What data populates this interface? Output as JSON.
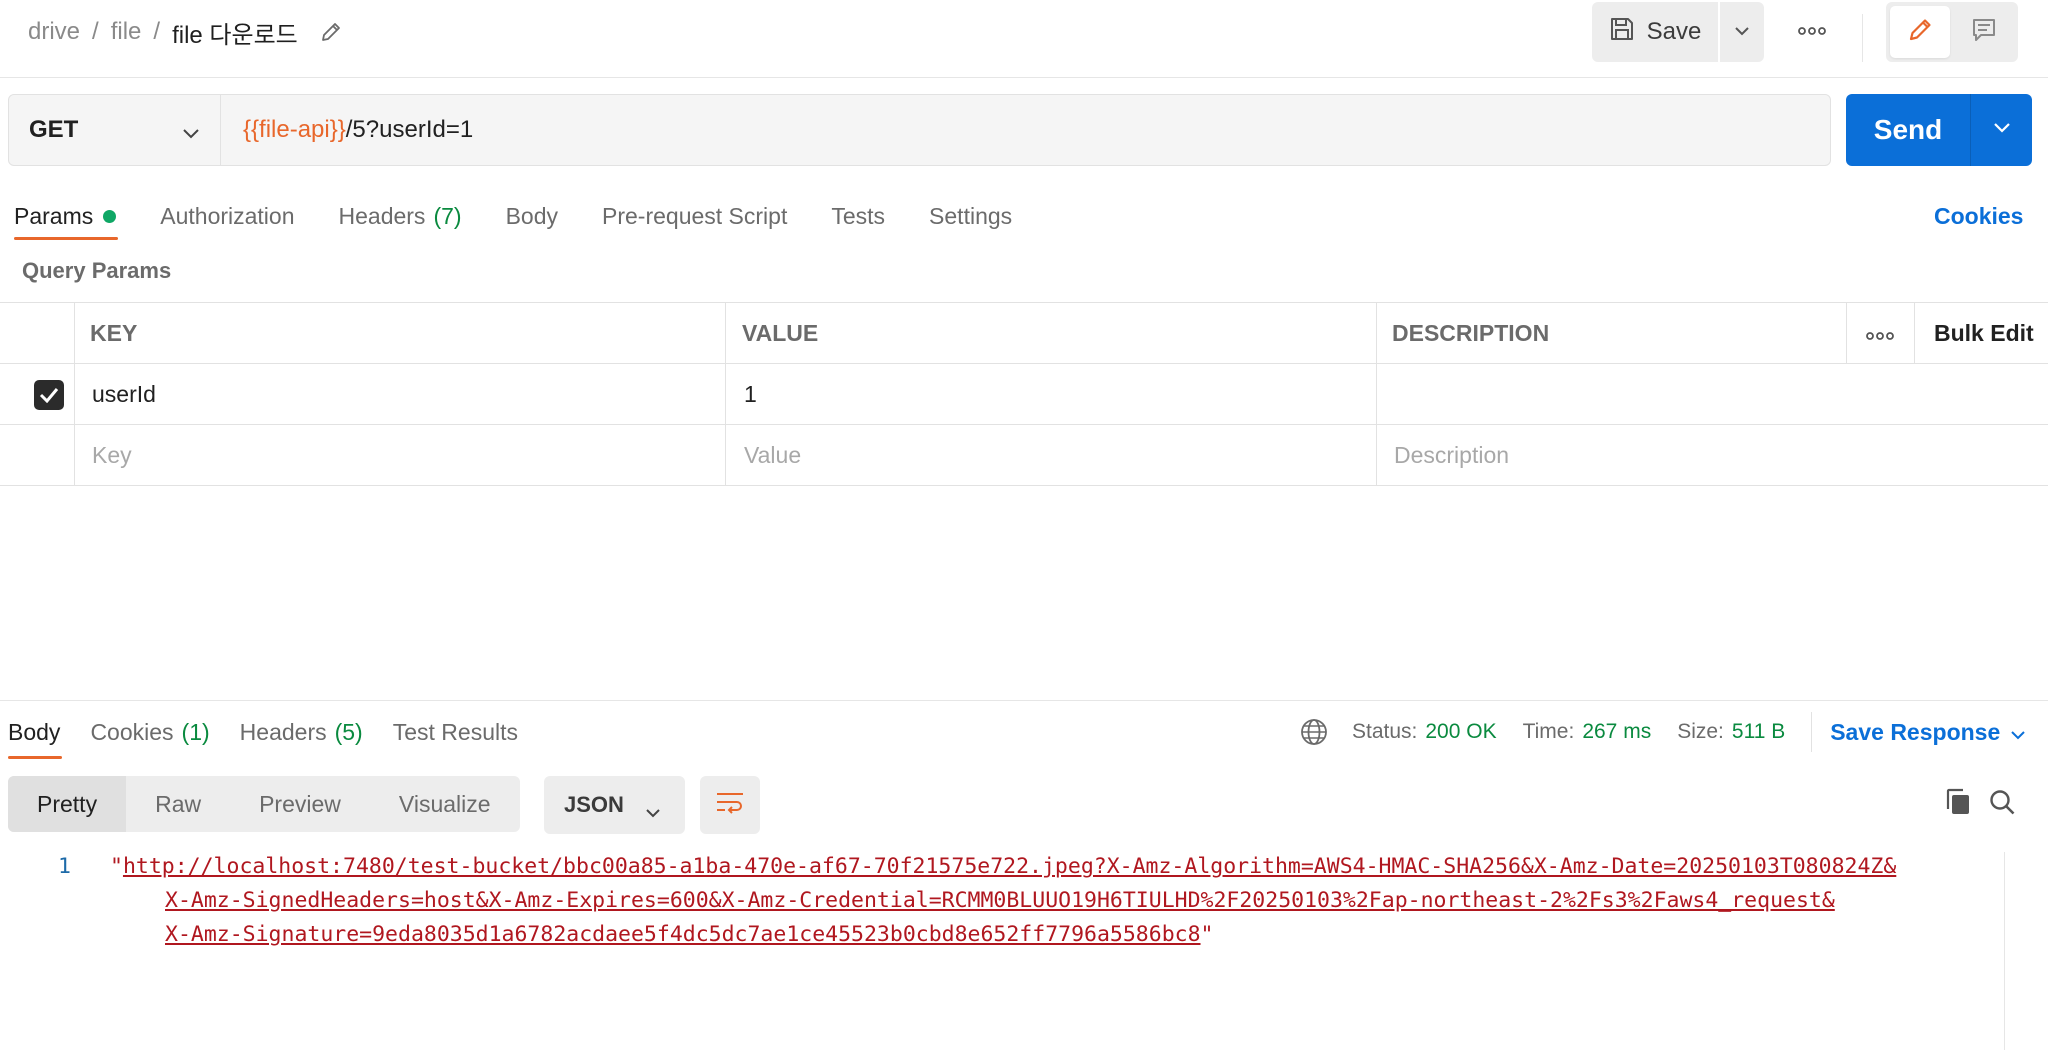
{
  "breadcrumb": {
    "root": "drive",
    "parent": "file",
    "current": "file 다운로드",
    "sep": "/"
  },
  "toolbar": {
    "save_label": "Save"
  },
  "request": {
    "method": "GET",
    "url_variable": "{{file-api}}",
    "url_path": "/5?userId=1",
    "send_label": "Send"
  },
  "request_tabs": {
    "params": "Params",
    "authorization": "Authorization",
    "headers": "Headers",
    "headers_count": "(7)",
    "body": "Body",
    "prerequest": "Pre-request Script",
    "tests": "Tests",
    "settings": "Settings",
    "cookies": "Cookies"
  },
  "query_params": {
    "title": "Query Params",
    "columns": {
      "key": "KEY",
      "value": "VALUE",
      "description": "DESCRIPTION"
    },
    "bulk_edit": "Bulk Edit",
    "rows": [
      {
        "key": "userId",
        "value": "1",
        "description": "",
        "enabled": true
      }
    ],
    "placeholders": {
      "key": "Key",
      "value": "Value",
      "description": "Description"
    }
  },
  "response_tabs": {
    "body": "Body",
    "cookies": "Cookies",
    "cookies_count": "(1)",
    "headers": "Headers",
    "headers_count": "(5)",
    "tests": "Test Results"
  },
  "response_meta": {
    "status_label": "Status:",
    "status_value": "200 OK",
    "time_label": "Time:",
    "time_value": "267 ms",
    "size_label": "Size:",
    "size_value": "511 B",
    "save_response": "Save Response"
  },
  "response_view": {
    "modes": [
      "Pretty",
      "Raw",
      "Preview",
      "Visualize"
    ],
    "format": "JSON"
  },
  "response_body": {
    "line_number": "1",
    "open_quote": "\"",
    "line1": "http://localhost:7480/test-bucket/bbc00a85-a1ba-470e-af67-70f21575e722.jpeg?X-Amz-Algorithm=AWS4-HMAC-SHA256&X-Amz-Date=20250103T080824Z&",
    "line2": "X-Amz-SignedHeaders=host&X-Amz-Expires=600&X-Amz-Credential=RCMM0BLUUO19H6TIULHD%2F20250103%2Fap-northeast-2%2Fs3%2Faws4_request&",
    "line3": "X-Amz-Signature=9eda8035d1a6782acdaee5f4dc5dc7ae1ce45523b0cbd8e652ff7796a5586bc8",
    "close_quote": "\""
  },
  "colors": {
    "accent": "#e8672b",
    "primary": "#0b6fd8",
    "success": "#0a8a3f",
    "string": "#b0171f"
  }
}
